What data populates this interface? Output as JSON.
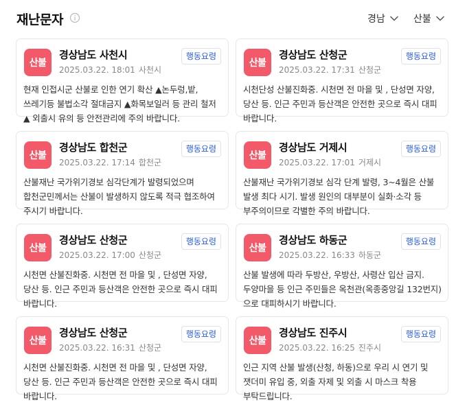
{
  "header": {
    "title": "재난문자",
    "info_icon": "info-circle-icon",
    "region_filter": "경남",
    "category_filter": "산불"
  },
  "cards": [
    {
      "badge": "산불",
      "title": "경상남도 사천시",
      "date": "2025.03.22. 18:01",
      "location": "사천시",
      "button": "행동요령",
      "message": "현재 인접시군 산불로 인한 연기 확산 ▲논두렁,밭, 쓰레기등 불법소각 절대금지 ▲화목보일러 등 관리 철저 ▲ 외출시 유의 등 안전관리에 주의 바랍니다."
    },
    {
      "badge": "산불",
      "title": "경상남도 산청군",
      "date": "2025.03.22. 17:31",
      "location": "산청군",
      "button": "행동요령",
      "message": "시천단성 산불진화중. 시천면 전 마을 및 , 단성면 자양, 당산 등. 인근 주민과 등산객은 안전한 곳으로 즉시 대피 바랍니다."
    },
    {
      "badge": "산불",
      "title": "경상남도 합천군",
      "date": "2025.03.22. 17:14",
      "location": "합천군",
      "button": "행동요령",
      "message": "산불재난 국가위기경보 심각단계가 발령되었으며 합천군민께서는 산불이 발생하지 않도록 적극 협조하여 주시기 바랍니다."
    },
    {
      "badge": "산불",
      "title": "경상남도 거제시",
      "date": "2025.03.22. 17:01",
      "location": "거제시",
      "button": "행동요령",
      "message": "산불재난 국가위기경보 심각 단계 발령, 3~4월은 산불 발생 최다 시기. 발생 원인의 대부분이 실화·소각 등 부주의이므로 각별한 주의 바랍니다."
    },
    {
      "badge": "산불",
      "title": "경상남도 산청군",
      "date": "2025.03.22. 17:00",
      "location": "산청군",
      "button": "행동요령",
      "message": "시천면 산불진화중. 시천면 전 마을 및 , 단성면 자양, 당산 등. 인근 주민과 등산객은 안전한 곳으로 즉시 대피 바랍니다."
    },
    {
      "badge": "산불",
      "title": "경상남도 하동군",
      "date": "2025.03.22. 16:33",
      "location": "하동군",
      "button": "행동요령",
      "message": "산불 발생에 따라 두방산, 우방산, 사령산 입산 금지. 두양마을 등 인근 주민들은 옥천관(옥종중앙길 132번지)으로 대피하시기 바랍니다."
    },
    {
      "badge": "산불",
      "title": "경상남도 산청군",
      "date": "2025.03.22. 16:31",
      "location": "산청군",
      "button": "행동요령",
      "message": "시천면 산불진화중. 시천면 전 마을 및 , 단성면 자양, 당산 등. 인근 주민과 등산객은 안전한 곳으로 즉시 대피 바랍니다."
    },
    {
      "badge": "산불",
      "title": "경상남도 진주시",
      "date": "2025.03.22. 16:25",
      "location": "진주시",
      "button": "행동요령",
      "message": "인근 지역 산불 발생(산청, 하동)으로 우리 시 연기 및 잿더미 유입 중, 외출 자제 및 외출 시 마스크 착용 부탁드립니다."
    }
  ]
}
